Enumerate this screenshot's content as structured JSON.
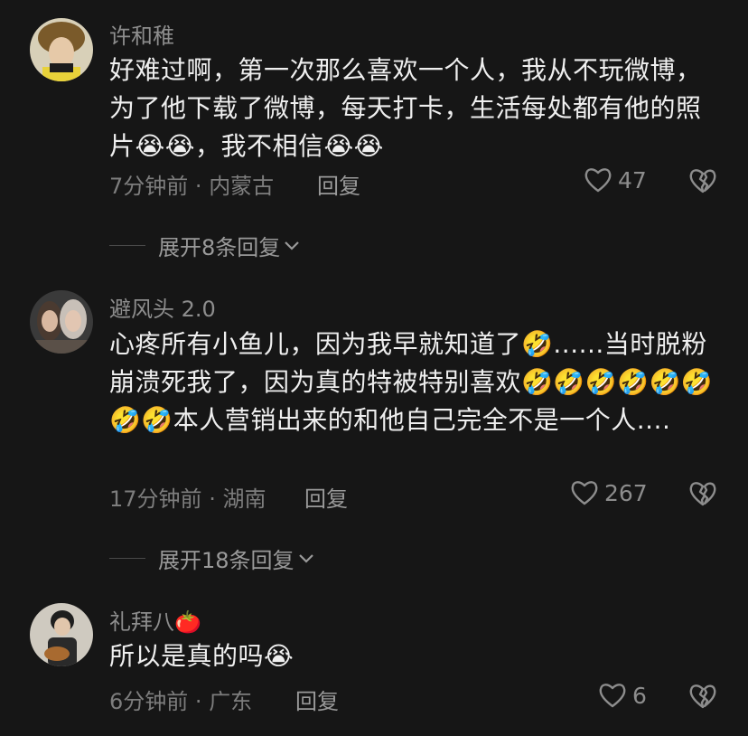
{
  "comments": [
    {
      "username": "许和稚",
      "text": "好难过啊，第一次那么喜欢一个人，我从不玩微博，为了他下载了微博，每天打卡，生活每处都有他的照片",
      "text_tail": "，我不相信",
      "emoji_pre_tail": "😭😭",
      "emoji_end": "😭😭",
      "time": "7分钟前",
      "location": "内蒙古",
      "reply_label": "回复",
      "likes": "47",
      "expand_label": "展开8条回复"
    },
    {
      "username": "避风头 2.0",
      "text_a": "心疼所有小鱼儿，因为我早就知道了",
      "emoji_a": "🤣",
      "text_b": "......当时脱粉崩溃死我了，因为真的特被特别喜欢",
      "emoji_b": "🤣🤣🤣🤣🤣🤣🤣🤣",
      "text_c": "本人营销出来的和他自己完全不是一个人....",
      "time": "17分钟前",
      "location": "湖南",
      "reply_label": "回复",
      "likes": "267",
      "expand_label": "展开18条回复"
    },
    {
      "username": "礼拜八",
      "username_emoji": "🍅",
      "text": "所以是真的吗",
      "emoji_end": "😭",
      "time": "6分钟前",
      "location": "广东",
      "reply_label": "回复",
      "likes": "6"
    }
  ]
}
